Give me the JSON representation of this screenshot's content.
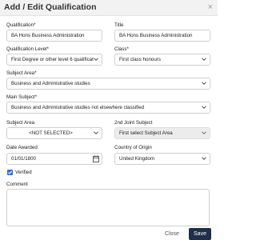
{
  "dialog": {
    "title": "Add / Edit Qualification",
    "close_glyph": "×"
  },
  "form": {
    "qualification": {
      "label": "Qualification*",
      "value": "BA Hons Business Administration"
    },
    "title": {
      "label": "Title",
      "value": "BA Hons Business Administration"
    },
    "qualification_level": {
      "label": "Qualification Level*",
      "value": "First Degree or other level 6 qualificat"
    },
    "class": {
      "label": "Class*",
      "value": "First class honours"
    },
    "subject_area_main": {
      "label": "Subject Area*",
      "value": "Business and Administrative studies"
    },
    "main_subject": {
      "label": "Main Subject*",
      "value": "Business and Administrative studies not elsewhere classified"
    },
    "subject_area": {
      "label": "Subject Area",
      "value": "<NOT SELECTED>"
    },
    "second_joint_subject": {
      "label": "2nd Joint Subject",
      "value": "First select Subject Area"
    },
    "date_awarded": {
      "label": "Date Awarded",
      "value": "01/01/1800"
    },
    "country_of_origin": {
      "label": "Country of Origin",
      "value": "United Kingdom"
    },
    "verified": {
      "label": "Verified",
      "checked": true
    },
    "comment": {
      "label": "Comment",
      "value": ""
    }
  },
  "footer": {
    "close_label": "Close",
    "save_label": "Save"
  },
  "colors": {
    "accent": "#2f6fdf",
    "save_bg": "#1f2e4a"
  }
}
